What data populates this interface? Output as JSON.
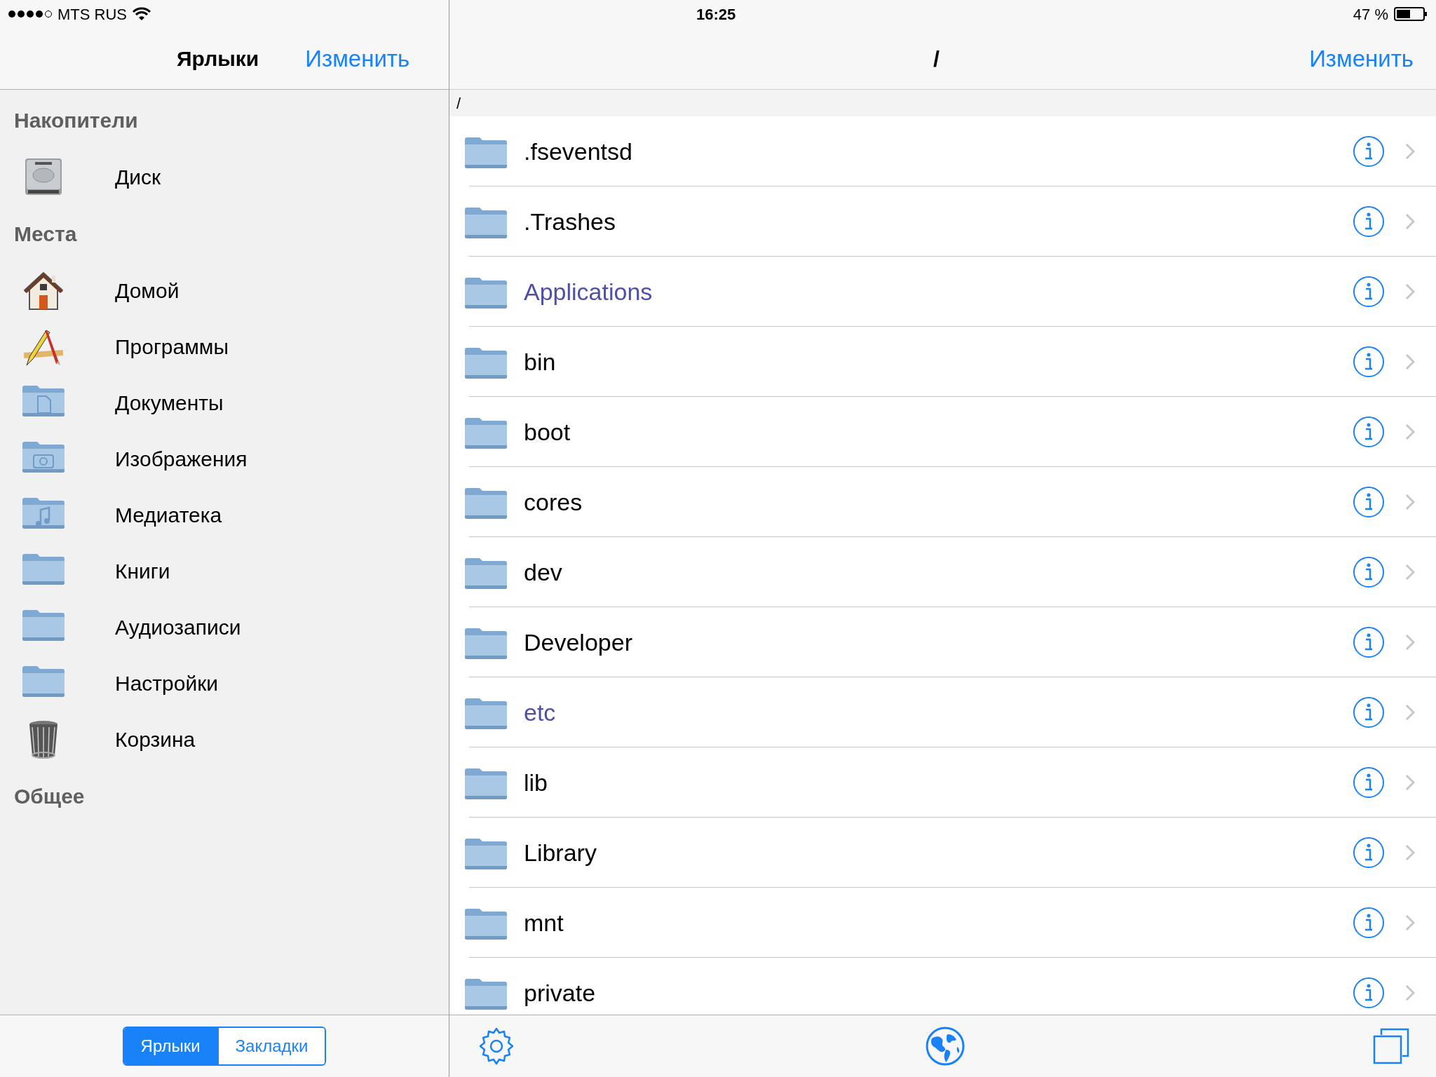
{
  "status_bar": {
    "carrier": "MTS RUS",
    "time": "16:25",
    "battery": "47 %"
  },
  "sidebar": {
    "title": "Ярлыки",
    "edit": "Изменить",
    "sections": [
      {
        "title": "Накопители",
        "items": [
          {
            "kind": "disk",
            "label": "Диск"
          }
        ]
      },
      {
        "title": "Места",
        "items": [
          {
            "kind": "home",
            "label": "Домой"
          },
          {
            "kind": "apps",
            "label": "Программы"
          },
          {
            "kind": "documents",
            "label": "Документы"
          },
          {
            "kind": "pictures",
            "label": "Изображения"
          },
          {
            "kind": "music",
            "label": "Медиатека"
          },
          {
            "kind": "folder",
            "label": "Книги"
          },
          {
            "kind": "folder",
            "label": "Аудиозаписи"
          },
          {
            "kind": "folder",
            "label": "Настройки"
          },
          {
            "kind": "trash",
            "label": "Корзина"
          }
        ]
      },
      {
        "title": "Общее"
      }
    ],
    "tabs": [
      {
        "label": "Ярлыки",
        "selected": true
      },
      {
        "label": "Закладки",
        "selected": false
      }
    ]
  },
  "browser": {
    "title": "/",
    "edit": "Изменить",
    "path": "/",
    "rows": [
      {
        "name": ".fseventsd",
        "kind": "folder"
      },
      {
        "name": ".Trashes",
        "kind": "folder"
      },
      {
        "name": "Applications",
        "kind": "link"
      },
      {
        "name": "bin",
        "kind": "folder"
      },
      {
        "name": "boot",
        "kind": "folder"
      },
      {
        "name": "cores",
        "kind": "folder"
      },
      {
        "name": "dev",
        "kind": "folder"
      },
      {
        "name": "Developer",
        "kind": "folder"
      },
      {
        "name": "etc",
        "kind": "link"
      },
      {
        "name": "lib",
        "kind": "folder"
      },
      {
        "name": "Library",
        "kind": "folder"
      },
      {
        "name": "mnt",
        "kind": "folder"
      },
      {
        "name": "private",
        "kind": "folder"
      }
    ]
  }
}
